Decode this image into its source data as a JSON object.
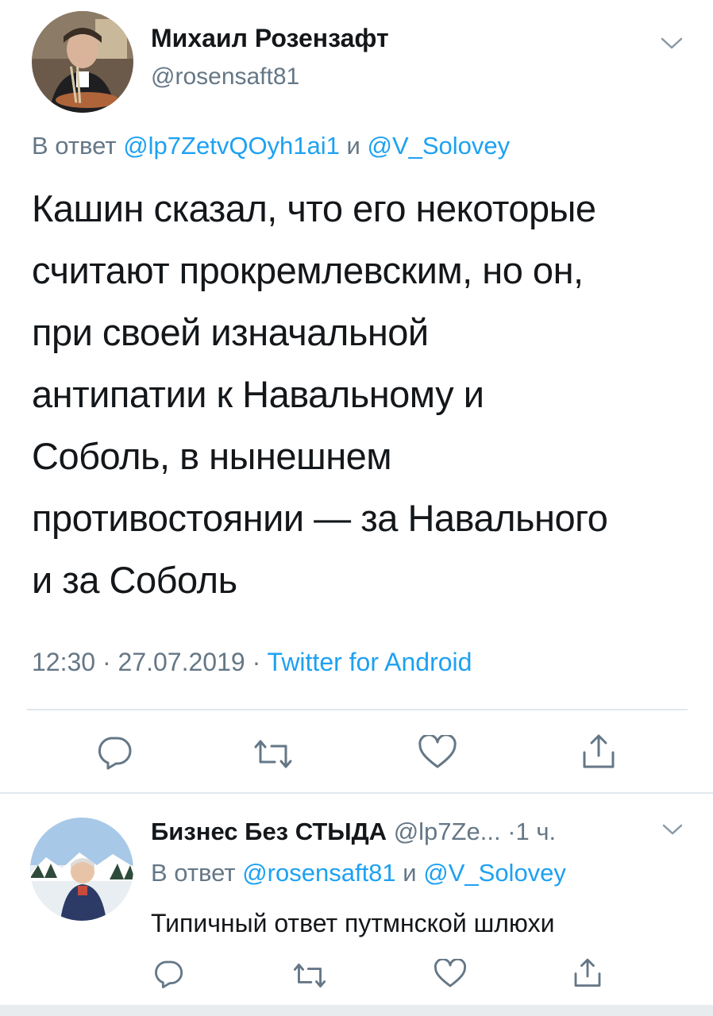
{
  "main_tweet": {
    "author_name": "Михаил Розензафт",
    "author_handle": "@rosensaft81",
    "reply_prefix": "В ответ",
    "reply_user1": "@lp7ZetvQOyh1ai1",
    "reply_joiner": "и",
    "reply_user2": "@V_Solovey",
    "text_lines": [
      "Кашин сказал, что его некоторые",
      "считают прокремлевским, но он,",
      "при своей изначальной",
      "антипатии к Навальному и",
      "Соболь, в нынешнем",
      "противостоянии — за Навального",
      "и за Соболь"
    ],
    "time": "12:30",
    "sep1": "·",
    "date": "27.07.2019",
    "sep2": "·",
    "client": "Twitter for Android"
  },
  "reply_tweet": {
    "author_name": "Бизнес Без СТЫДА",
    "author_handle": "@lp7Ze...",
    "age": "·1 ч.",
    "reply_prefix": "В ответ",
    "reply_user1": "@rosensaft81",
    "reply_joiner": "и",
    "reply_user2": "@V_Solovey",
    "text": "Типичный ответ путмнской шлюхи"
  },
  "colors": {
    "accent": "#1da1f2",
    "muted": "#657786",
    "text": "#14171a",
    "divider": "#e1e8ed"
  },
  "icons": [
    "chevron-down-icon",
    "reply-icon",
    "retweet-icon",
    "like-icon",
    "share-icon"
  ]
}
